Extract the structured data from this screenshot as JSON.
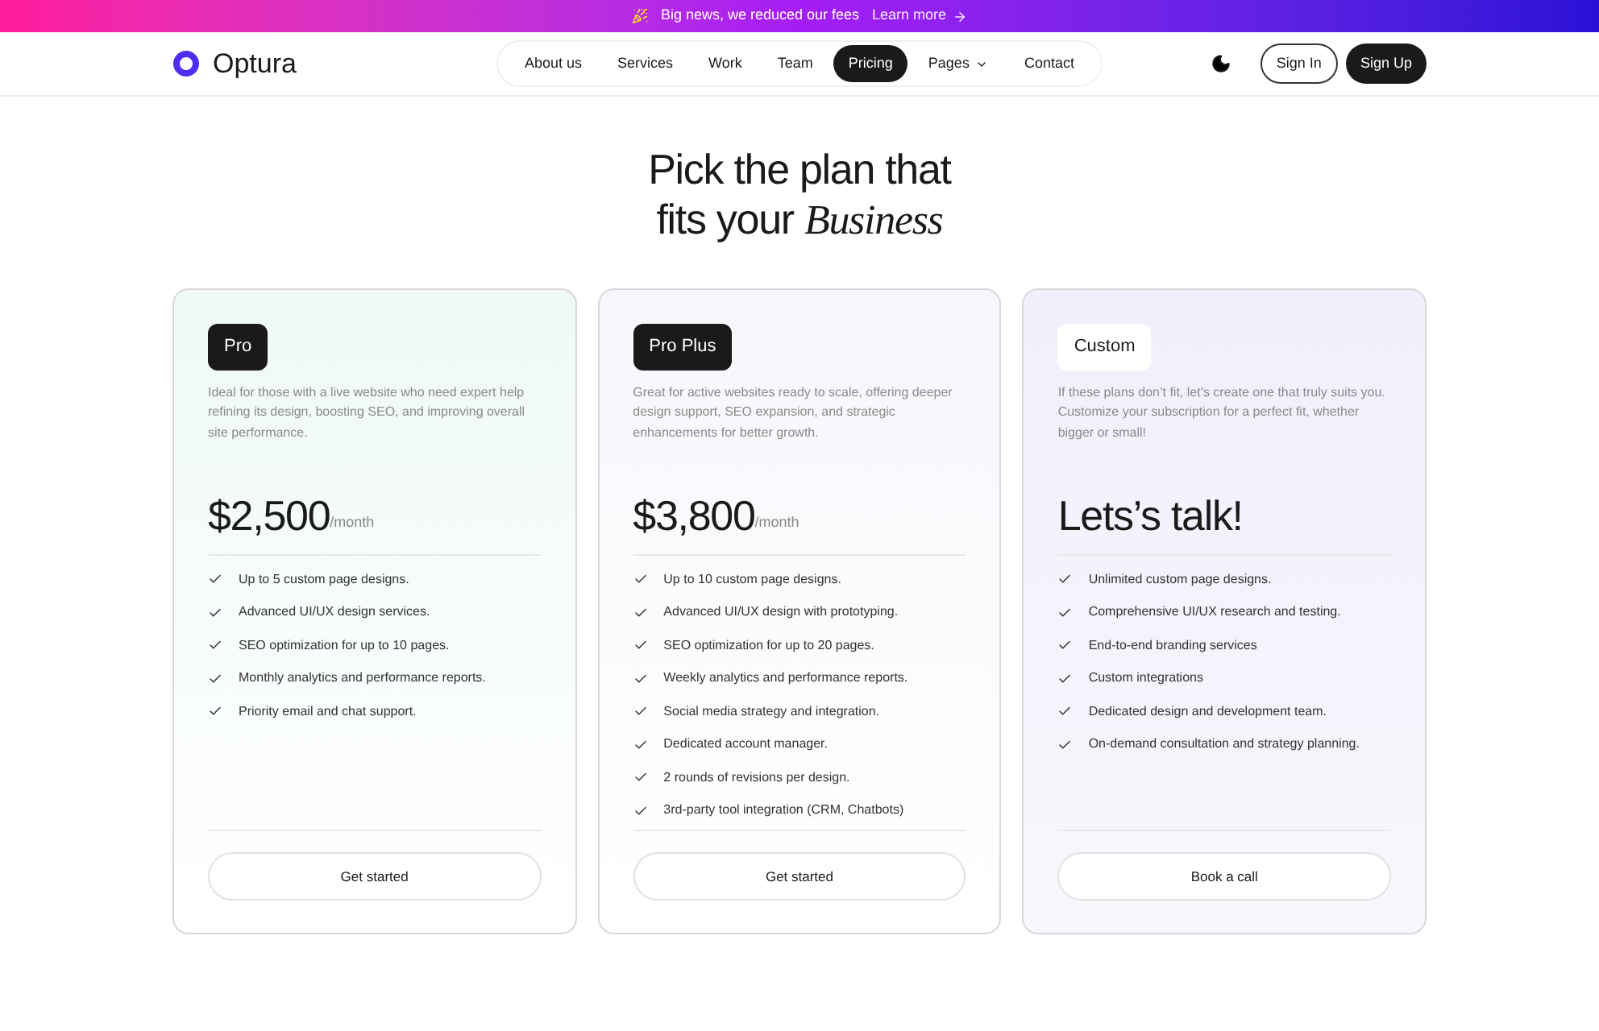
{
  "banner": {
    "text": "Big news, we reduced our fees",
    "link": "Learn more"
  },
  "header": {
    "logo": "Optura",
    "nav": [
      {
        "label": "About us",
        "selected": false,
        "dropdown": false
      },
      {
        "label": "Services",
        "selected": false,
        "dropdown": false
      },
      {
        "label": "Work",
        "selected": false,
        "dropdown": false
      },
      {
        "label": "Team",
        "selected": false,
        "dropdown": false
      },
      {
        "label": "Pricing",
        "selected": true,
        "dropdown": false
      },
      {
        "label": "Pages",
        "selected": false,
        "dropdown": true
      },
      {
        "label": "Contact",
        "selected": false,
        "dropdown": false
      }
    ],
    "sign_in": "Sign In",
    "sign_up": "Sign Up"
  },
  "heading": {
    "line1": "Pick the plan that",
    "line2": "fits your *Business*"
  },
  "plans": [
    {
      "name": "Pro",
      "kind": "dark",
      "description": "Ideal for those with a live website who need expert help refining its design, boosting SEO, and improving overall site performance.",
      "price": "$2,500",
      "period": "/month",
      "features": [
        "Up to 5 custom page designs.",
        "Advanced UI/UX design services.",
        "SEO optimization for up to 10 pages.",
        "Monthly analytics and performance reports.",
        "Priority email and chat support."
      ],
      "button": "Get started"
    },
    {
      "name": "Pro Plus",
      "kind": "dark",
      "description": "Great for active websites ready to scale, offering deeper design support, SEO expansion, and strategic enhancements for better growth.",
      "price": "$3,800",
      "period": "/month",
      "features": [
        "Up to 10 custom page designs.",
        "Advanced UI/UX design with prototyping.",
        "SEO optimization for up to 20 pages.",
        "Weekly analytics and performance reports.",
        "Social media strategy and integration.",
        "Dedicated account manager.",
        "2 rounds of revisions per design.",
        "3rd-party tool integration (CRM, Chatbots)"
      ],
      "button": "Get started"
    },
    {
      "name": "Custom",
      "kind": "light",
      "description": "If these plans don’t fit, let’s create one that truly suits you. Customize your subscription for a perfect fit, whether bigger or small!",
      "price": "Lets’s talk!",
      "features": [
        "Unlimited custom page designs.",
        "Comprehensive UI/UX research and testing.",
        "End-to-end branding services",
        "Custom integrations",
        "Dedicated design and development team.",
        "On-demand consultation and strategy planning."
      ],
      "button": "Book a call"
    }
  ]
}
